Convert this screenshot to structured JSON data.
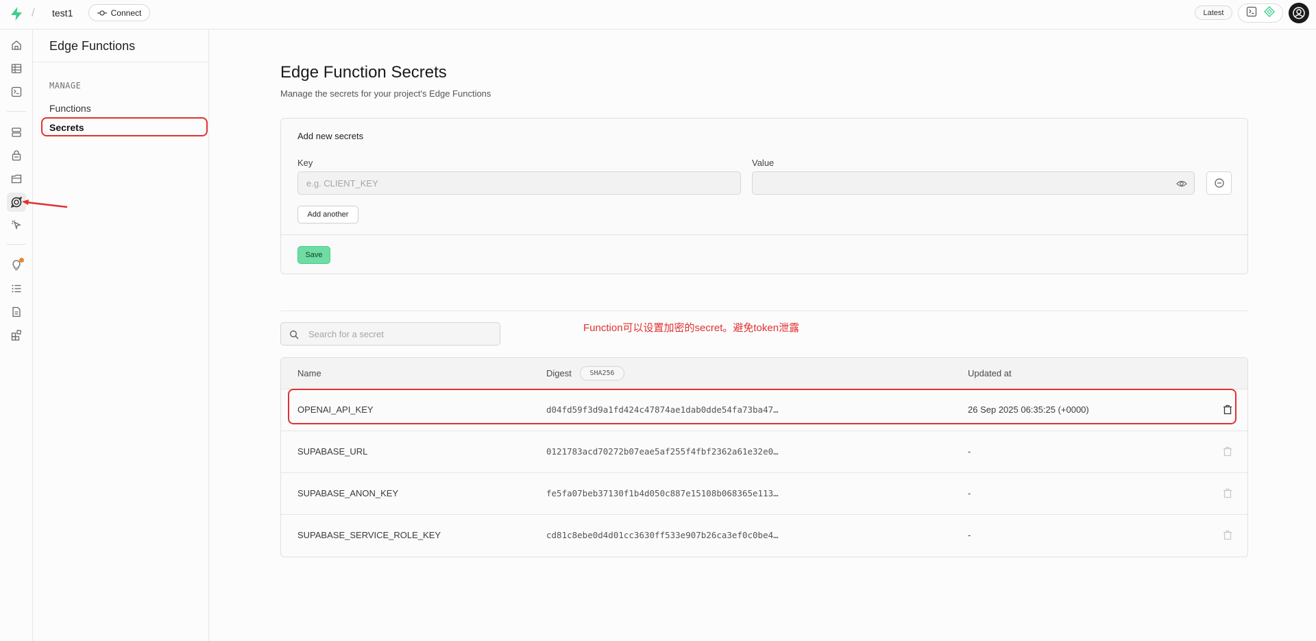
{
  "topbar": {
    "separator": "/",
    "project_name": "test1",
    "connect_label": "Connect",
    "version_label": "Latest"
  },
  "rail": {
    "icons": [
      "home-icon",
      "table-editor-icon",
      "sql-editor-icon",
      "database-icon",
      "auth-icon",
      "storage-icon",
      "edge-functions-icon",
      "realtime-icon",
      "advisors-icon",
      "logs-icon",
      "api-docs-icon",
      "integrations-icon"
    ],
    "active": "edge-functions-icon",
    "notification_color": "#e8862f"
  },
  "menu": {
    "title": "Edge Functions",
    "section": "MANAGE",
    "items": [
      {
        "label": "Functions"
      },
      {
        "label": "Secrets"
      }
    ],
    "selected": "Secrets"
  },
  "main": {
    "title": "Edge Function Secrets",
    "subtitle": "Manage the secrets for your project's Edge Functions",
    "add_panel": {
      "title": "Add new secrets",
      "key_label": "Key",
      "key_placeholder": "e.g. CLIENT_KEY",
      "value_label": "Value",
      "value": "",
      "add_another_label": "Add another",
      "save_label": "Save"
    },
    "search_placeholder": "Search for a secret",
    "annotation": "Function可以设置加密的secret。避免token泄露",
    "table": {
      "columns": {
        "name": "Name",
        "digest": "Digest",
        "digest_badge": "SHA256",
        "updated": "Updated at"
      },
      "rows": [
        {
          "name": "OPENAI_API_KEY",
          "digest": "d04fd59f3d9a1fd424c47874ae1dab0dde54fa73ba47…",
          "updated": "26 Sep 2025 06:35:25 (+0000)"
        },
        {
          "name": "SUPABASE_URL",
          "digest": "0121783acd70272b07eae5af255f4fbf2362a61e32e0…",
          "updated": "-"
        },
        {
          "name": "SUPABASE_ANON_KEY",
          "digest": "fe5fa07beb37130f1b4d050c887e15108b068365e113…",
          "updated": "-"
        },
        {
          "name": "SUPABASE_SERVICE_ROLE_KEY",
          "digest": "cd81c8ebe0d4d01cc3630ff533e907b26ca3ef0c0be4…",
          "updated": "-"
        }
      ]
    }
  },
  "colors": {
    "brand": "#3ecf8e",
    "annotation": "#e03131"
  }
}
